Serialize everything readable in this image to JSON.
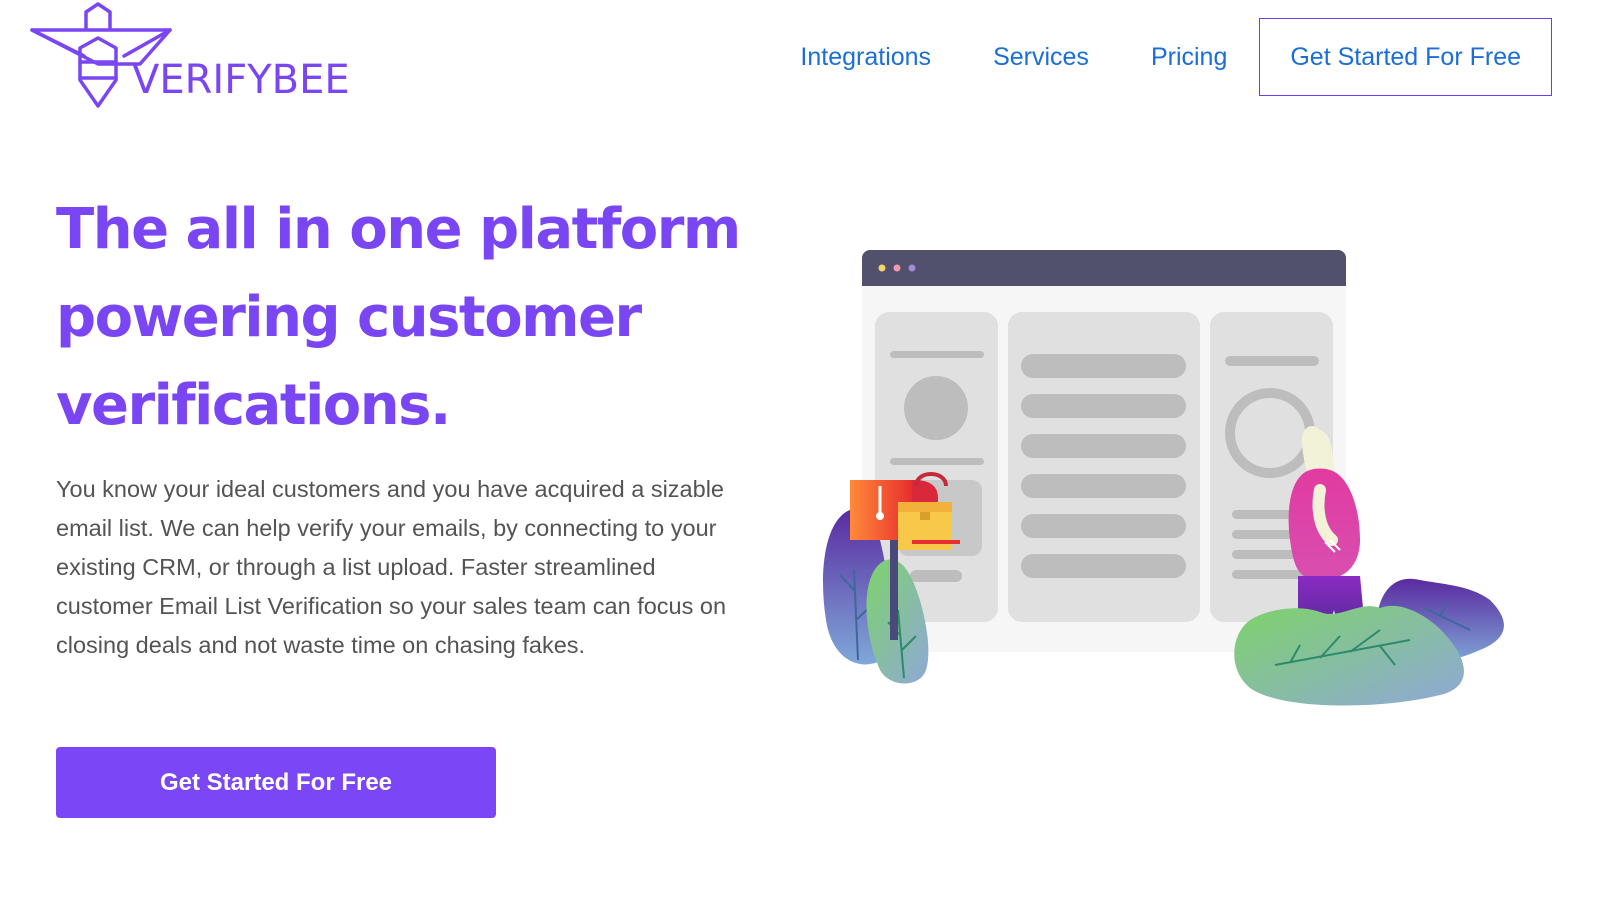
{
  "brand": {
    "name": "VERIFYBEE",
    "color": "#7a46f3"
  },
  "nav": {
    "links": [
      "Integrations",
      "Services",
      "Pricing"
    ],
    "cta_label": "Get Started For Free",
    "link_color": "#1b6ed8"
  },
  "hero": {
    "title_lines": [
      "The all in one platform",
      "powering customer",
      "verifications."
    ],
    "paragraph": "You know your ideal customers and you have acquired a sizable email list. We can help verify your emails, by connecting to your existing CRM, or through a list upload. Faster streamlined customer Email List Verification so your sales team can focus on closing deals and not waste time on chasing fakes.",
    "cta_label": "Get Started For Free",
    "cta_color": "#7b46f5"
  },
  "illustration": {
    "icon": "browser-window-illustration"
  }
}
